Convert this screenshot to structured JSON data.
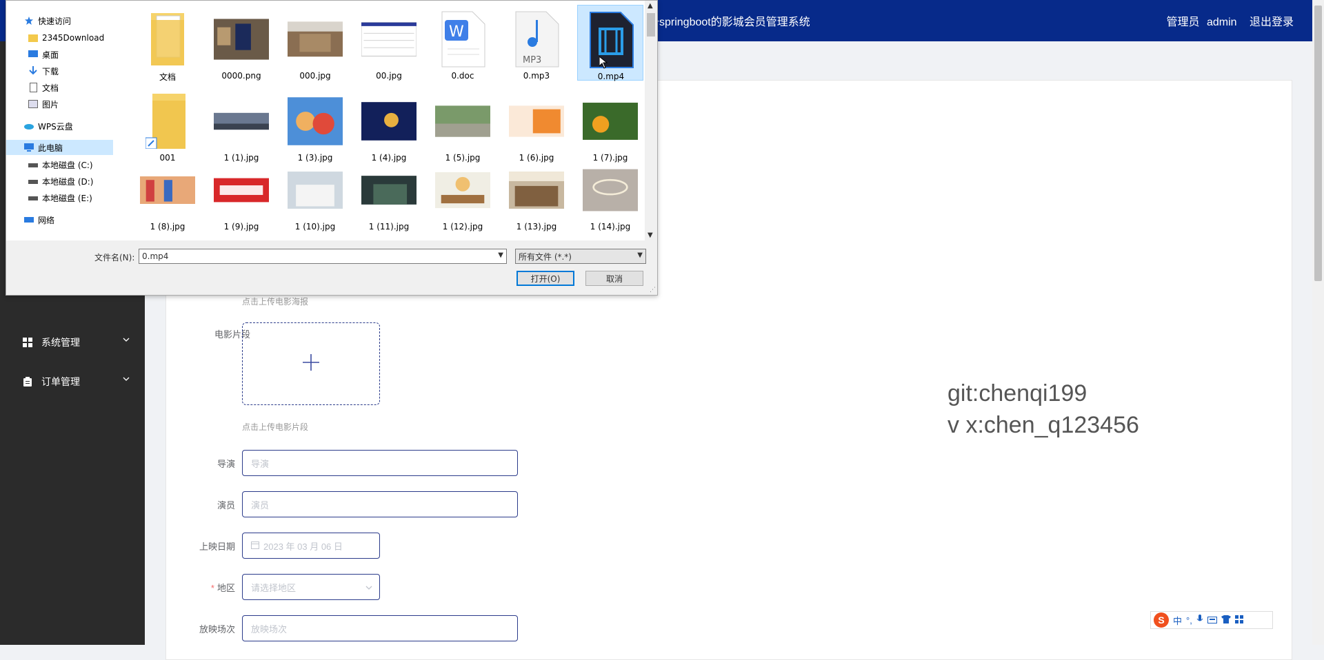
{
  "topbar": {
    "title": "于springboot的影城会员管理系统",
    "user_role": "管理员",
    "user_name": "admin",
    "logout": "退出登录"
  },
  "sidebar": {
    "items": [
      {
        "label": "系统管理",
        "icon": "grid-icon"
      },
      {
        "label": "订单管理",
        "icon": "clipboard-icon"
      }
    ]
  },
  "watermark": {
    "line1": "git:chenqi199",
    "line2": "v x:chen_q123456"
  },
  "form": {
    "poster_hint": "点击上传电影海报",
    "clip_label": "电影片段",
    "clip_hint": "点击上传电影片段",
    "director_label": "导演",
    "director_placeholder": "导演",
    "actor_label": "演员",
    "actor_placeholder": "演员",
    "date_label": "上映日期",
    "date_value": "2023 年 03 月 06 日",
    "region_label": "地区",
    "region_placeholder": "请选择地区",
    "session_label": "放映场次",
    "session_placeholder": "放映场次"
  },
  "dialog": {
    "nav": [
      {
        "label": "快速访问",
        "icon": "star-icon",
        "pinned": false
      },
      {
        "label": "2345Download",
        "icon": "folder-icon",
        "pinned": true
      },
      {
        "label": "桌面",
        "icon": "desktop-icon",
        "pinned": true
      },
      {
        "label": "下载",
        "icon": "download-icon",
        "pinned": true
      },
      {
        "label": "文档",
        "icon": "document-icon",
        "pinned": true
      },
      {
        "label": "图片",
        "icon": "picture-icon",
        "pinned": true
      },
      {
        "label": "WPS云盘",
        "icon": "cloud-icon",
        "pinned": false
      },
      {
        "label": "此电脑",
        "icon": "computer-icon",
        "pinned": false
      },
      {
        "label": "本地磁盘 (C:)",
        "icon": "drive-icon",
        "pinned": false
      },
      {
        "label": "本地磁盘 (D:)",
        "icon": "drive-icon",
        "pinned": false
      },
      {
        "label": "本地磁盘 (E:)",
        "icon": "drive-icon",
        "pinned": false
      },
      {
        "label": "网络",
        "icon": "network-icon",
        "pinned": false
      }
    ],
    "files": [
      "文档",
      "0000.png",
      "000.jpg",
      "00.jpg",
      "0.doc",
      "0.mp3",
      "0.mp4",
      "001",
      "1 (1).jpg",
      "1 (3).jpg",
      "1 (4).jpg",
      "1 (5).jpg",
      "1 (6).jpg",
      "1 (7).jpg",
      "1 (8).jpg",
      "1 (9).jpg",
      "1 (10).jpg",
      "1 (11).jpg",
      "1 (12).jpg",
      "1 (13).jpg",
      "1 (14).jpg"
    ],
    "selected_file": "0.mp4",
    "filename_label": "文件名(N):",
    "filename_value": "0.mp4",
    "filetype_value": "所有文件 (*.*)",
    "open_label": "打开(O)",
    "cancel_label": "取消"
  },
  "ime": {
    "logo": "S",
    "lang": "中"
  }
}
